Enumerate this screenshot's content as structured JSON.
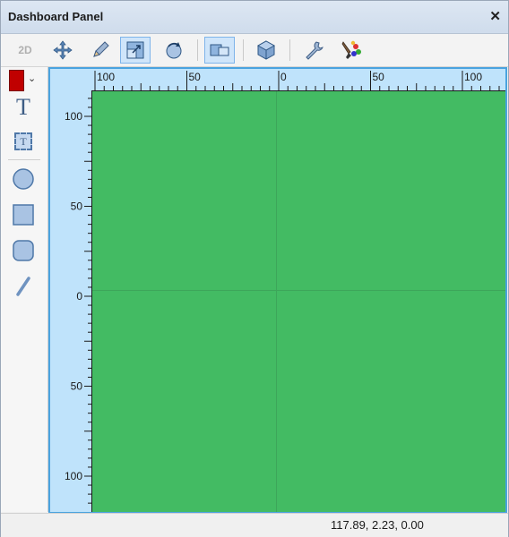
{
  "panel": {
    "title": "Dashboard Panel",
    "close_glyph": "✕"
  },
  "toolbar": {
    "mode_label": "2D",
    "tools": [
      "move-icon",
      "pencil-icon",
      "resize-icon",
      "rotate-icon",
      "flat-view-icon",
      "cube-icon",
      "wrench-icon",
      "brush-palette-icon"
    ],
    "active_tools": [
      "resize-icon",
      "flat-view-icon"
    ]
  },
  "left_tools": {
    "color": "#c00000",
    "dropdown_glyph": "⌄",
    "text_tool_glyph": "T",
    "text_box_glyph": "T",
    "shapes": [
      "circle-icon",
      "rectangle-icon",
      "rounded-rectangle-icon",
      "line-icon"
    ]
  },
  "rulers": {
    "horizontal_labels": [
      "100",
      "50",
      "0",
      "50",
      "100"
    ],
    "vertical_labels": [
      "100",
      "50",
      "0",
      "50",
      "100"
    ]
  },
  "canvas": {
    "background": "#43bb63"
  },
  "status": {
    "coordinates": "117.89, 2.23, 0.00"
  }
}
